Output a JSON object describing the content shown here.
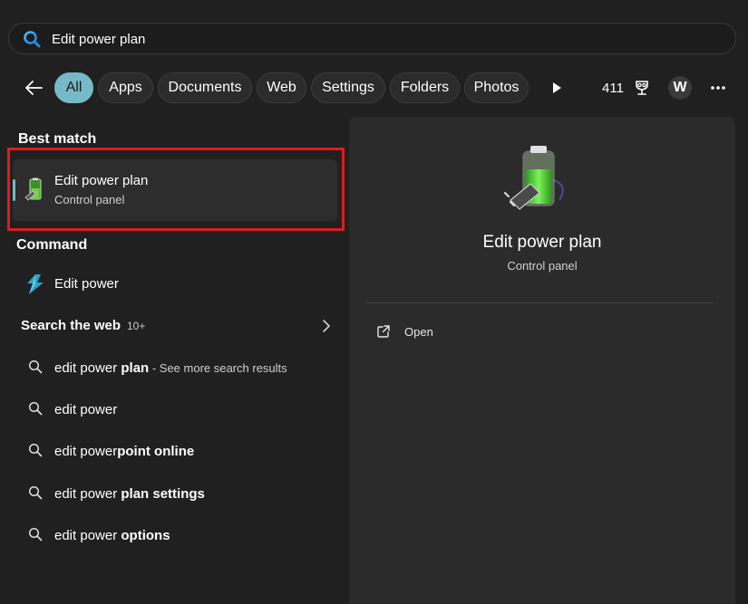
{
  "search": {
    "value": "Edit power plan",
    "icon": "search-icon"
  },
  "filters": {
    "chips": [
      "All",
      "Apps",
      "Documents",
      "Web",
      "Settings",
      "Folders",
      "Photos"
    ],
    "active": "All",
    "points": "411",
    "avatar_letter": "W"
  },
  "colors": {
    "background": "#202020",
    "accent": "#76b9c7",
    "highlight_border": "#e01b1b",
    "preview_pane": "#2b2b2b"
  },
  "best_match": {
    "heading": "Best match",
    "title": "Edit power plan",
    "subtitle": "Control panel",
    "icon": "power-plan-icon"
  },
  "command": {
    "heading": "Command",
    "label": "Edit power",
    "icon": "command-icon"
  },
  "web": {
    "heading": "Search the web",
    "count": "10+",
    "items": [
      {
        "prefix": "edit power ",
        "bold": "plan",
        "hint": " - See more search results"
      },
      {
        "prefix": "edit power",
        "bold": "",
        "hint": ""
      },
      {
        "prefix": "edit power",
        "bold": "point online",
        "hint": ""
      },
      {
        "prefix": "edit power ",
        "bold": "plan settings",
        "hint": ""
      },
      {
        "prefix": "edit power ",
        "bold": "options",
        "hint": ""
      }
    ]
  },
  "preview": {
    "title": "Edit power plan",
    "subtitle": "Control panel",
    "open_label": "Open",
    "icon": "power-plan-icon"
  }
}
